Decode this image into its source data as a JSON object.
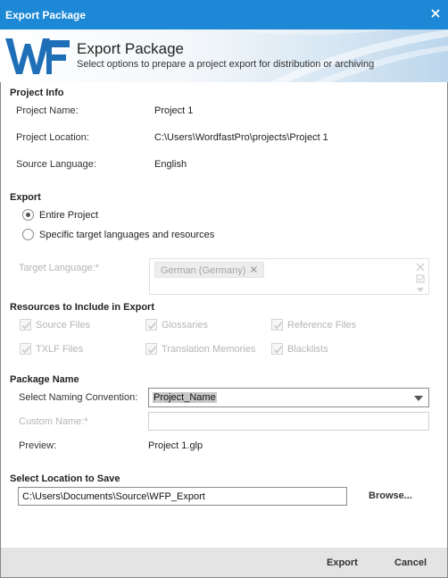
{
  "window": {
    "title": "Export Package"
  },
  "header": {
    "title": "Export Package",
    "subtitle": "Select options to prepare a project export for distribution or archiving"
  },
  "project_info": {
    "heading": "Project Info",
    "name_label": "Project Name:",
    "name_value": "Project 1",
    "location_label": "Project Location:",
    "location_value": "C:\\Users\\WordfastPro\\projects\\Project 1",
    "language_label": "Source Language:",
    "language_value": "English"
  },
  "export": {
    "heading": "Export",
    "entire_project": "Entire Project",
    "entire_project_selected": true,
    "specific": "Specific target languages and resources",
    "specific_selected": false,
    "target_language_label": "Target Language:*",
    "target_language_tag": "German (Germany)"
  },
  "resources": {
    "heading": "Resources to Include in Export",
    "items": [
      {
        "label": "Source Files",
        "checked": true
      },
      {
        "label": "Glossaries",
        "checked": true
      },
      {
        "label": "Reference Files",
        "checked": true
      },
      {
        "label": "TXLF Files",
        "checked": true
      },
      {
        "label": "Translation Memories",
        "checked": true
      },
      {
        "label": "Blacklists",
        "checked": true
      }
    ]
  },
  "package_name": {
    "heading": "Package Name",
    "convention_label": "Select Naming Convention:",
    "convention_value": "Project_Name",
    "custom_label": "Custom Name:*",
    "custom_value": "",
    "preview_label": "Preview:",
    "preview_value": "Project 1.glp"
  },
  "save_location": {
    "heading": "Select Location to Save",
    "path": "C:\\Users\\Documents\\Source\\WFP_Export",
    "browse": "Browse..."
  },
  "footer": {
    "export": "Export",
    "cancel": "Cancel"
  },
  "colors": {
    "titlebar": "#1c88d6",
    "logo": "#1f6fb8"
  },
  "icons": {
    "close": "close-icon",
    "logo": "wordfast-logo",
    "tag_remove": "remove-tag-icon",
    "dropdown": "chevron-down-icon"
  }
}
